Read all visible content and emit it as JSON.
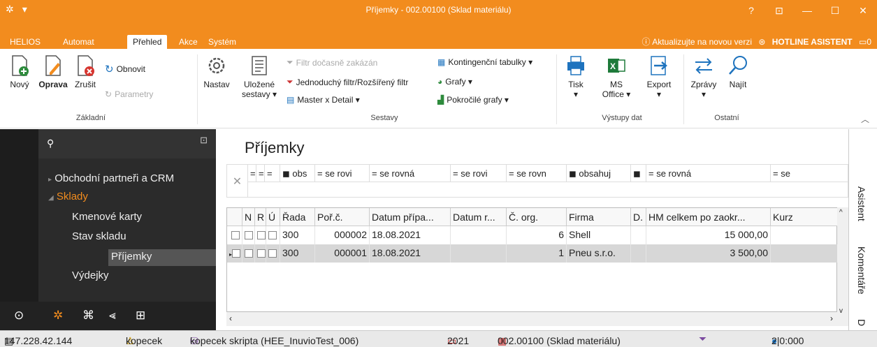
{
  "window": {
    "title": "Příjemky - 002.00100 (Sklad materiálu)"
  },
  "menu_tabs": [
    "HELIOS",
    "Automat",
    "Přehled",
    "Akce",
    "Systém"
  ],
  "menu_right": {
    "update": "Aktualizujte na novou verzi",
    "hotline": "HOTLINE ASISTENT",
    "count": "0"
  },
  "ribbon": {
    "novy": "Nový",
    "oprava": "Oprava",
    "zrusit": "Zrušit",
    "obnovit": "Obnovit",
    "parametry": "Parametry",
    "group_zakladni": "Základní",
    "nastav": "Nastav",
    "ulozene": "Uložené",
    "sestavy": "sestavy ▾",
    "filtr": "Filtr dočasně zakázán",
    "jednoduchy": "Jednoduchý filtr/Rozšířený filtr",
    "master": "Master x Detail ▾",
    "kontingencni": "Kontingenční tabulky ▾",
    "grafy": "Grafy ▾",
    "pokrocile": "Pokročilé grafy ▾",
    "group_sestavy": "Sestavy",
    "tisk": "Tisk",
    "ms": "MS",
    "office": "Office ▾",
    "export": "Export",
    "group_vystupy": "Výstupy dat",
    "zpravy": "Zprávy",
    "najit": "Najít",
    "group_ostatni": "Ostatní"
  },
  "nav": {
    "items": [
      "Obchodní partneři a CRM",
      "Sklady",
      "Kmenové karty",
      "Stav skladu",
      "Příjemky",
      "Výdejky"
    ]
  },
  "main": {
    "title": "Příjemky"
  },
  "filters": [
    "=",
    "=",
    "=",
    "obs",
    "= se rovi",
    "= se rovná",
    "= se rovi",
    "= se rovn",
    "obsahuj",
    "",
    "= se rovná",
    "= se"
  ],
  "columns": [
    "N",
    "R",
    "Ú",
    "Řada",
    "Poř.č.",
    "Datum přípa...",
    "Datum r...",
    "Č. org.",
    "Firma",
    "D.",
    "HM celkem po zaokr...",
    "Kurz"
  ],
  "rows": [
    {
      "rada": "300",
      "porc": "000002",
      "datum": "18.08.2021",
      "corg": "6",
      "firma": "Shell",
      "hm": "15 000,00"
    },
    {
      "rada": "300",
      "porc": "000001",
      "datum": "18.08.2021",
      "corg": "1",
      "firma": "Pneu s.r.o.",
      "hm": "3 500,00"
    }
  ],
  "right_tabs": [
    "Asistent",
    "Komentáře",
    "D"
  ],
  "status": {
    "ip": "147.228.42.144",
    "user": "kopecek",
    "db": "kopecek skripta (HEE_InuvioTest_006)",
    "year": "2021",
    "sklad": "002.00100 (Sklad materiálu)",
    "count": "2|0:000"
  },
  "colors": {
    "accent": "#f28c1e",
    "nav_bg": "#2b2b2b"
  }
}
